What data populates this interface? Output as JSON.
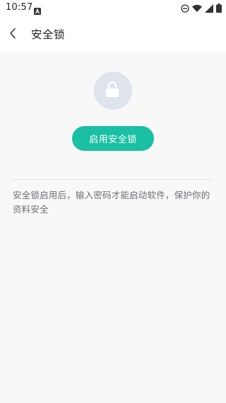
{
  "status_bar": {
    "time": "10:57",
    "icons": [
      "notification-a-icon",
      "do-not-disturb-icon",
      "wifi-icon",
      "signal-icon",
      "battery-icon"
    ]
  },
  "header": {
    "title": "安全锁",
    "back_icon": "chevron-left-icon"
  },
  "main": {
    "lock_icon": "unlocked-padlock-icon",
    "enable_button_label": "启用安全锁",
    "description": "安全锁启用后，输入密码才能启动软件，保护你的资料安全"
  },
  "colors": {
    "accent": "#1bbfa3",
    "lock_circle": "#dfe4ec",
    "background": "#f8f8f9"
  }
}
